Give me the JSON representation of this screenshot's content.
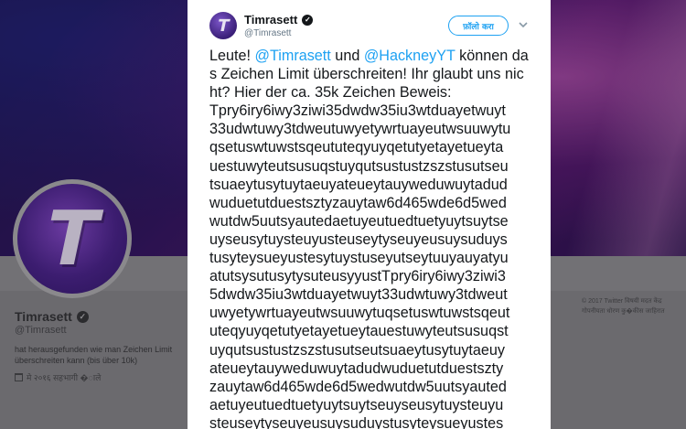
{
  "background_profile": {
    "name": "Timrasett",
    "handle": "@Timrasett",
    "bio": "hat herausgefunden wie man Zeichen Limit überschreiten kann (bis über 10k)",
    "joined": "मे २०१६ सहभागी �ाले",
    "footer": "© 2017 Twitter  विषयी  मदत केंद्र  गोपनीयता धोरण  कु�कीस  जाहिरात"
  },
  "tweet": {
    "author_name": "Timrasett",
    "author_handle": "@Timrasett",
    "follow_label": "फ़ॉलो करा",
    "text_intro": "Leute! ",
    "mention_1": "@Timrasett",
    "text_and": " und ",
    "mention_2": "@HackneyYT",
    "text_after": " können das Zeichen Limit überschreiten! Ihr glaubt uns nicht? Hier der ca. 35k Zeichen Beweis:",
    "lines": [
      "Tpry6iry6iwy3ziwi35dwdw35iu3wtduayetwuyt",
      "33udwtuwy3tdweutuwyetywrtuayeutwsuuwytu",
      "qsetuswtuwstsqeututeqyuyqetutyetayetueyta",
      "uestuwyteutsusuqstuyqutsustustzszstusutseu",
      "tsuaeytusytuytaeuyateueytauyweduwuytadud",
      "wuduetutduestsztyzauytaw6d465wde6d5wed",
      "wutdw5uutsyautedaetuyeutuedtuetyuytsuytse",
      "uyseusytuysteuyusteuseytyseuyeusuysuduys",
      "tusyteysueyustesytuystuseyutseytuuyauyatyu",
      "atutsysutusytysuteusyyustTpry6iry6iwy3ziwi3",
      "5dwdw35iu3wtduayetwuyt33udwtuwy3tdweut",
      "uwyetywrtuayeutwsuuwytuqsetuswtuwstsqeut",
      "uteqyuyqetutyetayetueytauestuwyteutsusuqst",
      "uyqutsustustzszstusutseutsuaeytusytuytaeuy",
      "ateueytauyweduwuytadudwuduetutduestszty",
      "zauytaw6d465wde6d5wedwutdw5uutsyauted",
      "aetuyeutuedtuetyuytsuytseuyseusytuysteuyu",
      "steuseytyseuyeusuysuduystusyteysueyustes"
    ]
  },
  "colors": {
    "link": "#1da1f2",
    "text": "#14171a",
    "muted": "#657786"
  },
  "icons": [
    "verified-icon",
    "chevron-down-icon",
    "calendar-icon"
  ]
}
